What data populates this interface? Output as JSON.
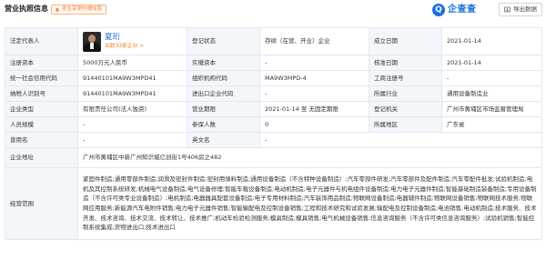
{
  "header": {
    "title": "营业执照信息",
    "update_label": "发生变更时通知我",
    "logo_badge": "Q",
    "logo_text": "企查查",
    "export_label": "导出数据"
  },
  "rows": [
    {
      "l1": "法定代表人",
      "l2": "登记状态",
      "v2": "存续（在营、开业）企业",
      "l3": "成立日期",
      "v3": "2021-01-14"
    },
    {
      "l1": "注册资本",
      "v1": "5000万元人民币",
      "l2": "实缴资本",
      "v2": "-",
      "l3": "核准日期",
      "v3": "2021-01-14"
    },
    {
      "l1": "统一社会信用代码",
      "v1": "91440101MA9W3MPD41",
      "l2": "组织机构代码",
      "v2": "MA9W3MPD-4",
      "l3": "工商注册号",
      "v3": "-"
    },
    {
      "l1": "纳税人识别号",
      "v1": "91440101MA9W3MPD41",
      "l2": "进出口企业代码",
      "v2": "-",
      "l3": "所属行业",
      "v3": "通用设备制造业"
    },
    {
      "l1": "企业类型",
      "v1": "有限责任公司(法人独资)",
      "l2": "营业期限",
      "v2": "2021-01-14 至 无固定期限",
      "l3": "登记机关",
      "v3": "广州市黄埔区市场监督管理局"
    },
    {
      "l1": "人员规模",
      "v1": "-",
      "l2": "参保人数",
      "v2": "0",
      "l3": "所属地区",
      "v3": "广东省"
    },
    {
      "l1": "曾用名",
      "v1": "-",
      "l2": "英文名",
      "v2": "-"
    }
  ],
  "legal_rep": {
    "name": "夏珩",
    "related": "关联33家企业 >"
  },
  "address": {
    "label": "企业地址",
    "value": "广州市黄埔区中新广州知识城亿创街1号406房之482"
  },
  "scope": {
    "label": "经营范围",
    "value": "紧固件制造;通用零部件制造;润滑及密封件制造;密封用填料制造;通用设备制造（不含特种设备制造）;汽车零部件研发;汽车零部件及配件制造;汽车零配件批发;试验机制造;电机及其控制系统研发;机械电气设备制造;电气设备修理;智能车载设备制造;电动机制造;电子元器件与机电组件设备制造;电力电子元器件制造;智能基础制造装备制造;专用设备制造（不含许可类专业设备制造）;电机制造;电器器具配套设备制造;电子专用材料制造;汽车装饰用品制造;物联网设备制造;电器辅件制造;物联网设备销售;物联网技术服务;物联网应用服务;新能源汽车电附件销售;电力电子元器件销售;智能输配电及控制设备销售;工程和技术研究和试验发展;输配电及控制设备制造;电池销售;电动机制造;技术服务、技术开发、技术咨询、技术交流、技术转让、技术推广;机动车检验检测服务;模具制造;模具销售;电气机械设备销售;信息咨询服务（不含许可类信息咨询服务）;试验机销售;智能控制系统集成;货物进出口;技术进出口"
  },
  "colors": {
    "accent": "#1d6ee0",
    "label_bg": "#f3f6fb",
    "border": "#e3e8ef",
    "orange": "#f0802f"
  }
}
